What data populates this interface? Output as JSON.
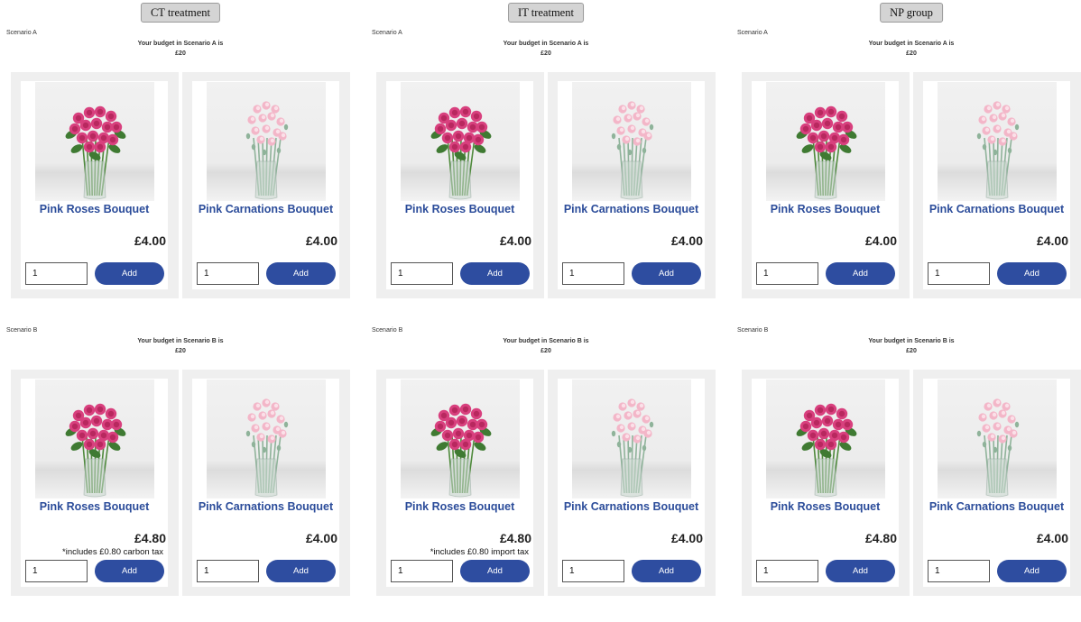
{
  "columns": [
    {
      "treatment_label": "CT treatment",
      "scenarios": [
        {
          "label": "Scenario A",
          "budget_line1": "Your budget in Scenario A is",
          "budget_line2": "£20",
          "products": [
            {
              "name": "Pink Roses Bouquet",
              "price": "£4.00",
              "note": "",
              "qty": "1",
              "add_label": "Add",
              "image": "pink-roses-bouquet-image"
            },
            {
              "name": "Pink Carnations Bouquet",
              "price": "£4.00",
              "note": "",
              "qty": "1",
              "add_label": "Add",
              "image": "pink-carnations-bouquet-image"
            }
          ]
        },
        {
          "label": "Scenario B",
          "budget_line1": "Your budget in Scenario B is",
          "budget_line2": "£20",
          "products": [
            {
              "name": "Pink Roses Bouquet",
              "price": "£4.80",
              "note": "*includes £0.80 carbon tax",
              "qty": "1",
              "add_label": "Add",
              "image": "pink-roses-bouquet-image"
            },
            {
              "name": "Pink Carnations Bouquet",
              "price": "£4.00",
              "note": "",
              "qty": "1",
              "add_label": "Add",
              "image": "pink-carnations-bouquet-image"
            }
          ]
        }
      ]
    },
    {
      "treatment_label": "IT treatment",
      "scenarios": [
        {
          "label": "Scenario A",
          "budget_line1": "Your budget in Scenario A is",
          "budget_line2": "£20",
          "products": [
            {
              "name": "Pink Roses Bouquet",
              "price": "£4.00",
              "note": "",
              "qty": "1",
              "add_label": "Add",
              "image": "pink-roses-bouquet-image"
            },
            {
              "name": "Pink Carnations Bouquet",
              "price": "£4.00",
              "note": "",
              "qty": "1",
              "add_label": "Add",
              "image": "pink-carnations-bouquet-image"
            }
          ]
        },
        {
          "label": "Scenario B",
          "budget_line1": "Your budget in Scenario B is",
          "budget_line2": "£20",
          "products": [
            {
              "name": "Pink Roses Bouquet",
              "price": "£4.80",
              "note": "*includes £0.80 import tax",
              "qty": "1",
              "add_label": "Add",
              "image": "pink-roses-bouquet-image"
            },
            {
              "name": "Pink Carnations Bouquet",
              "price": "£4.00",
              "note": "",
              "qty": "1",
              "add_label": "Add",
              "image": "pink-carnations-bouquet-image"
            }
          ]
        }
      ]
    },
    {
      "treatment_label": "NP group",
      "scenarios": [
        {
          "label": "Scenario A",
          "budget_line1": "Your budget in Scenario A is",
          "budget_line2": "£20",
          "products": [
            {
              "name": "Pink Roses Bouquet",
              "price": "£4.00",
              "note": "",
              "qty": "1",
              "add_label": "Add",
              "image": "pink-roses-bouquet-image"
            },
            {
              "name": "Pink Carnations Bouquet",
              "price": "£4.00",
              "note": "",
              "qty": "1",
              "add_label": "Add",
              "image": "pink-carnations-bouquet-image"
            }
          ]
        },
        {
          "label": "Scenario B",
          "budget_line1": "Your budget in Scenario B is",
          "budget_line2": "£20",
          "products": [
            {
              "name": "Pink Roses Bouquet",
              "price": "£4.80",
              "note": "",
              "qty": "1",
              "add_label": "Add",
              "image": "pink-roses-bouquet-image"
            },
            {
              "name": "Pink Carnations Bouquet",
              "price": "£4.00",
              "note": "",
              "qty": "1",
              "add_label": "Add",
              "image": "pink-carnations-bouquet-image"
            }
          ]
        }
      ]
    }
  ],
  "colors": {
    "product_name": "#2b4c9a",
    "add_button": "#2e4da0",
    "card_frame": "#efefef",
    "rose": "#d8407e",
    "carnation": "#f3b6c8",
    "stem": "#4f8a3c"
  }
}
